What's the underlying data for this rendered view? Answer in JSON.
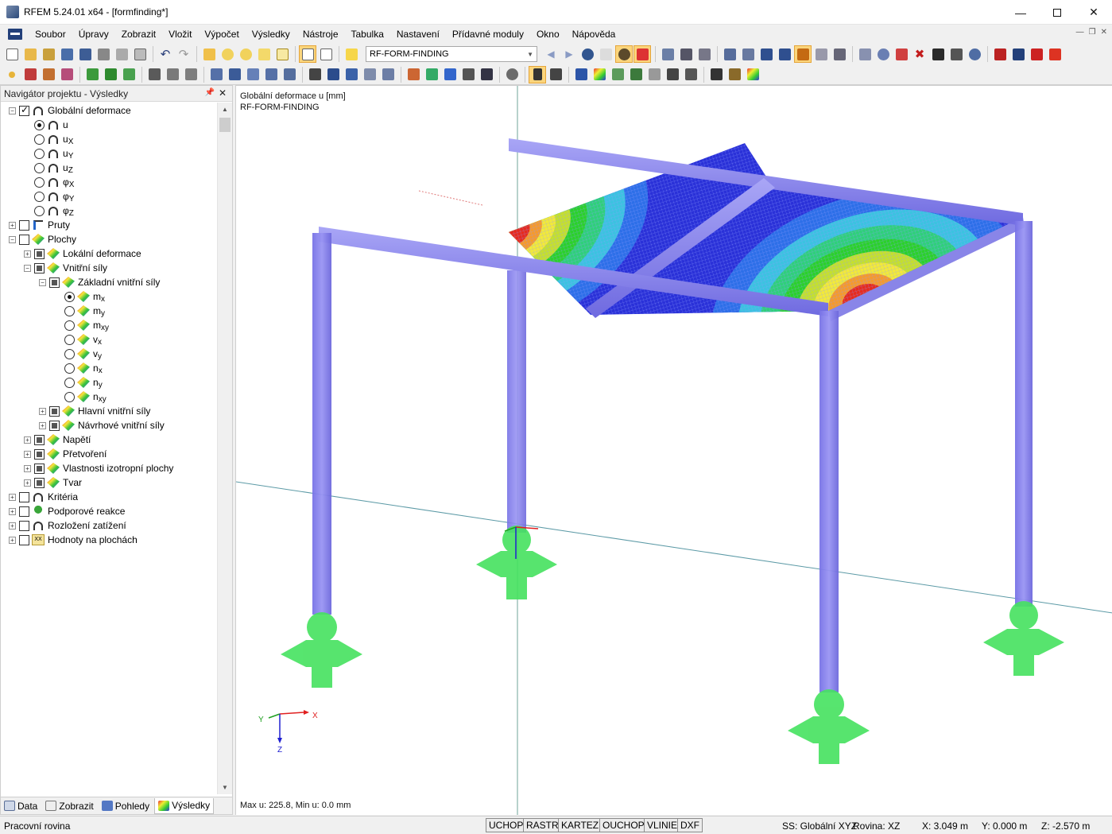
{
  "window": {
    "title": "RFEM 5.24.01 x64 - [formfinding*]",
    "minimize_icon": "minimize-icon",
    "maximize_icon": "maximize-icon",
    "close_icon": "close-icon"
  },
  "menu": {
    "items": [
      "Soubor",
      "Úpravy",
      "Zobrazit",
      "Vložit",
      "Výpočet",
      "Výsledky",
      "Nástroje",
      "Tabulka",
      "Nastavení",
      "Přídavné moduly",
      "Okno",
      "Nápověda"
    ]
  },
  "toolbar": {
    "loadcase_value": "RF-FORM-FINDING",
    "accent_active": "#fbd57c"
  },
  "navigator": {
    "title": "Navigátor projektu - Výsledky",
    "tree": [
      {
        "label": "Globální deformace",
        "sub": "",
        "level": 0,
        "expander": "minus",
        "control": "check-on",
        "icon": "deformation"
      },
      {
        "label": "u",
        "sub": "",
        "level": 1,
        "expander": "none",
        "control": "radio-on",
        "icon": "deformation"
      },
      {
        "label": "u",
        "sub": "X",
        "level": 1,
        "expander": "none",
        "control": "radio",
        "icon": "deformation"
      },
      {
        "label": "u",
        "sub": "Y",
        "level": 1,
        "expander": "none",
        "control": "radio",
        "icon": "deformation"
      },
      {
        "label": "u",
        "sub": "Z",
        "level": 1,
        "expander": "none",
        "control": "radio",
        "icon": "deformation"
      },
      {
        "label": "φ",
        "sub": "X",
        "level": 1,
        "expander": "none",
        "control": "radio",
        "icon": "deformation"
      },
      {
        "label": "φ",
        "sub": "Y",
        "level": 1,
        "expander": "none",
        "control": "radio",
        "icon": "deformation"
      },
      {
        "label": "φ",
        "sub": "Z",
        "level": 1,
        "expander": "none",
        "control": "radio",
        "icon": "deformation"
      },
      {
        "label": "Pruty",
        "sub": "",
        "level": 0,
        "expander": "plus",
        "control": "check",
        "icon": "member"
      },
      {
        "label": "Plochy",
        "sub": "",
        "level": 0,
        "expander": "minus",
        "control": "check",
        "icon": "surface"
      },
      {
        "label": "Lokální deformace",
        "sub": "",
        "level": 1,
        "expander": "plus",
        "control": "check-part",
        "icon": "surface"
      },
      {
        "label": "Vnitřní síly",
        "sub": "",
        "level": 1,
        "expander": "minus",
        "control": "check-part",
        "icon": "surface"
      },
      {
        "label": "Základní vnitřní síly",
        "sub": "",
        "level": 2,
        "expander": "minus",
        "control": "check-part",
        "icon": "surface"
      },
      {
        "label": "m",
        "sub": "x",
        "level": 3,
        "expander": "none",
        "control": "radio-on",
        "icon": "surface"
      },
      {
        "label": "m",
        "sub": "y",
        "level": 3,
        "expander": "none",
        "control": "radio",
        "icon": "surface"
      },
      {
        "label": "m",
        "sub": "xy",
        "level": 3,
        "expander": "none",
        "control": "radio",
        "icon": "surface"
      },
      {
        "label": "v",
        "sub": "x",
        "level": 3,
        "expander": "none",
        "control": "radio",
        "icon": "surface"
      },
      {
        "label": "v",
        "sub": "y",
        "level": 3,
        "expander": "none",
        "control": "radio",
        "icon": "surface"
      },
      {
        "label": "n",
        "sub": "x",
        "level": 3,
        "expander": "none",
        "control": "radio",
        "icon": "surface"
      },
      {
        "label": "n",
        "sub": "y",
        "level": 3,
        "expander": "none",
        "control": "radio",
        "icon": "surface"
      },
      {
        "label": "n",
        "sub": "xy",
        "level": 3,
        "expander": "none",
        "control": "radio",
        "icon": "surface"
      },
      {
        "label": "Hlavní vnitřní síly",
        "sub": "",
        "level": 2,
        "expander": "plus",
        "control": "check-part",
        "icon": "surface"
      },
      {
        "label": "Návrhové vnitřní síly",
        "sub": "",
        "level": 2,
        "expander": "plus",
        "control": "check-part",
        "icon": "surface"
      },
      {
        "label": "Napětí",
        "sub": "",
        "level": 1,
        "expander": "plus",
        "control": "check-part",
        "icon": "surface"
      },
      {
        "label": "Přetvoření",
        "sub": "",
        "level": 1,
        "expander": "plus",
        "control": "check-part",
        "icon": "surface"
      },
      {
        "label": "Vlastnosti izotropní plochy",
        "sub": "",
        "level": 1,
        "expander": "plus",
        "control": "check-part",
        "icon": "surface"
      },
      {
        "label": "Tvar",
        "sub": "",
        "level": 1,
        "expander": "plus",
        "control": "check-part",
        "icon": "surface"
      },
      {
        "label": "Kritéria",
        "sub": "",
        "level": 0,
        "expander": "plus",
        "control": "check",
        "icon": "deformation"
      },
      {
        "label": "Podporové reakce",
        "sub": "",
        "level": 0,
        "expander": "plus",
        "control": "check",
        "icon": "support"
      },
      {
        "label": "Rozložení zatížení",
        "sub": "",
        "level": 0,
        "expander": "plus",
        "control": "check",
        "icon": "deformation"
      },
      {
        "label": "Hodnoty na plochách",
        "sub": "",
        "level": 0,
        "expander": "plus",
        "control": "check",
        "icon": "xx"
      }
    ],
    "tabs": [
      {
        "label": "Data",
        "icon": "data-icon"
      },
      {
        "label": "Zobrazit",
        "icon": "display-icon"
      },
      {
        "label": "Pohledy",
        "icon": "views-icon"
      },
      {
        "label": "Výsledky",
        "icon": "results-icon"
      }
    ]
  },
  "viewport": {
    "line1": "Globální deformace u [mm]",
    "line2": "RF-FORM-FINDING",
    "footer": "Max u: 225.8, Min u: 0.0 mm",
    "axis_labels": {
      "x": "X",
      "y": "Y",
      "z": "Z"
    },
    "colors": {
      "frame": "#8a86ee",
      "support": "#3ee05a",
      "mesh_low": "#2b2fd6",
      "mesh_high": "#e62b1e"
    }
  },
  "status": {
    "left": "Pracovní rovina",
    "toggles": [
      "UCHOP",
      "RASTR",
      "KARTEZ",
      "OUCHOP",
      "VLINIE",
      "DXF"
    ],
    "coord_system": "SS: Globální XYZ",
    "plane": "Rovina: XZ",
    "x": "X:  3.049 m",
    "y": "Y:  0.000 m",
    "z": "Z:  -2.570 m"
  }
}
